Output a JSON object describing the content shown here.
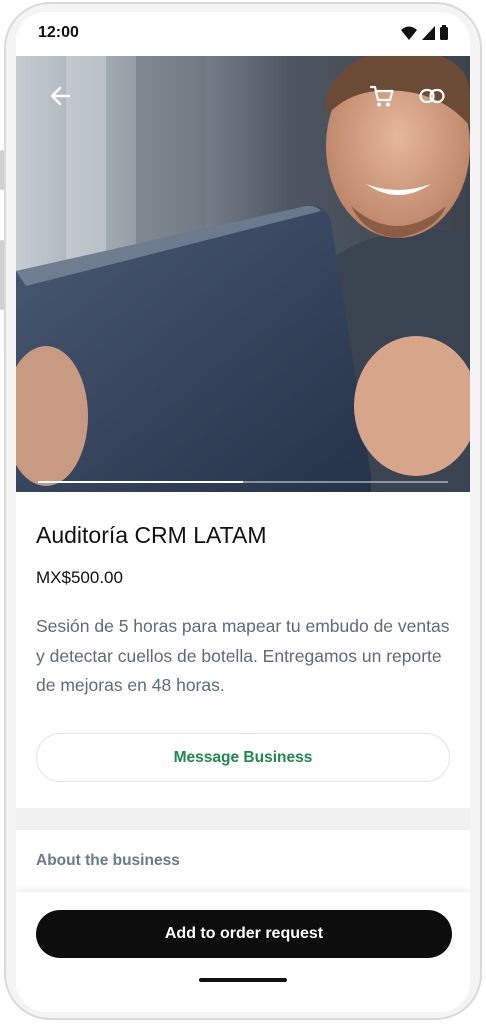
{
  "status_bar": {
    "time": "12:00",
    "icons": [
      "wifi-icon",
      "signal-icon",
      "battery-icon"
    ]
  },
  "hero": {
    "image_description": "smiling man holding a tablet",
    "carousel_progress": 0.5,
    "back_icon": "arrow-left-icon",
    "cart_icon": "cart-icon",
    "link_icon": "link-icon"
  },
  "product": {
    "title": "Auditoría CRM LATAM",
    "price": "MX$500.00",
    "description": "Sesión de 5 horas para mapear tu embudo de ventas y detectar cuellos de botella. Entregamos un reporte de mejoras en 48 horas."
  },
  "actions": {
    "message_business": "Message Business",
    "add_to_order": "Add to order request"
  },
  "sections": {
    "about_business": "About the business"
  },
  "colors": {
    "accent_green": "#1f8a4c",
    "primary_button": "#0d0d0d",
    "description_text": "#5d6b7a"
  }
}
